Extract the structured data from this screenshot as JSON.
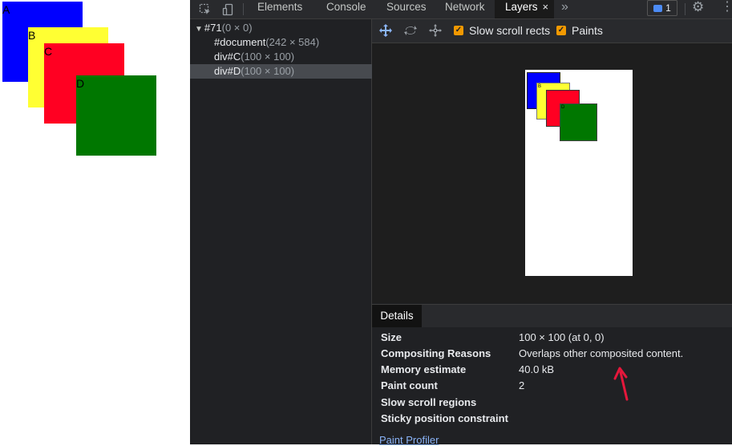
{
  "page_preview": {
    "squares": [
      {
        "label": "A",
        "color": "#0000ff"
      },
      {
        "label": "B",
        "color": "#ffff33"
      },
      {
        "label": "C",
        "color": "#ff0022"
      },
      {
        "label": "D",
        "color": "#007700"
      }
    ]
  },
  "tabbar": {
    "inspect_icon": "inspect-element-icon",
    "device_icon": "device-toolbar-icon",
    "tabs": [
      {
        "label": "Elements"
      },
      {
        "label": "Console"
      },
      {
        "label": "Sources"
      },
      {
        "label": "Network"
      },
      {
        "label": "Layers",
        "active": true
      }
    ],
    "close_glyph": "×",
    "more_glyph": "»",
    "issues_count": "1",
    "gear_glyph": "⚙",
    "kebab_glyph": "⋮"
  },
  "layer_tree": {
    "root": {
      "name": "#71",
      "dims": "(0 × 0)"
    },
    "children": [
      {
        "name": "#document",
        "dims": "(242 × 584)"
      },
      {
        "name": "div#C",
        "dims": "(100 × 100)"
      },
      {
        "name": "div#D",
        "dims": "(100 × 100)",
        "selected": true
      }
    ]
  },
  "toolbar": {
    "pan_icon": "pan-mode-icon",
    "rotate_icon": "rotate-mode-icon",
    "reset_icon": "reset-transform-icon",
    "slow_scroll_label": "Slow scroll rects",
    "paints_label": "Paints",
    "checkmark": "✓"
  },
  "viewport_preview": {
    "labels": [
      "B",
      "D"
    ]
  },
  "details": {
    "tab_label": "Details",
    "rows": [
      {
        "key": "Size",
        "value": "100 × 100 (at 0, 0)"
      },
      {
        "key": "Compositing Reasons",
        "value": "Overlaps other composited content."
      },
      {
        "key": "Memory estimate",
        "value": "40.0 kB"
      },
      {
        "key": "Paint count",
        "value": "2"
      },
      {
        "key": "Slow scroll regions",
        "value": ""
      },
      {
        "key": "Sticky position constraint",
        "value": ""
      }
    ],
    "paint_profiler_link": "Paint Profiler"
  },
  "colors": {
    "accent_blue": "#8ab4f8",
    "checkbox_orange": "#f29900",
    "annotation_red": "#e5173b"
  }
}
